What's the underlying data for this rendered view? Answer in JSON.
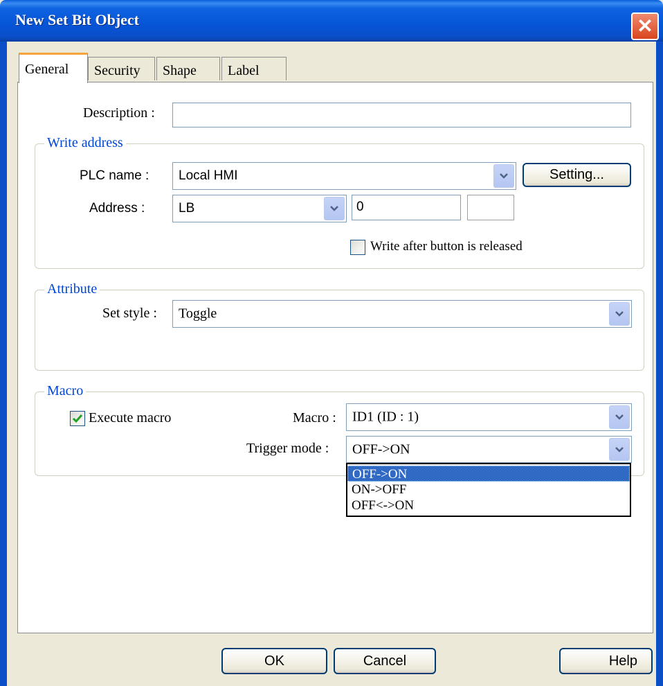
{
  "window": {
    "title": "New  Set Bit Object"
  },
  "tabs": [
    {
      "label": "General",
      "active": true
    },
    {
      "label": "Security",
      "active": false
    },
    {
      "label": "Shape",
      "active": false
    },
    {
      "label": "Label",
      "active": false
    }
  ],
  "description": {
    "label": "Description :",
    "value": ""
  },
  "write_address": {
    "title": "Write address",
    "plc_name_label": "PLC name :",
    "plc_name_value": "Local HMI",
    "setting_button": "Setting...",
    "address_label": "Address :",
    "address_device": "LB",
    "address_value": "0",
    "write_after_release_label": "Write after button is released",
    "write_after_release_checked": false
  },
  "attribute": {
    "title": "Attribute",
    "set_style_label": "Set style :",
    "set_style_value": "Toggle"
  },
  "macro": {
    "title": "Macro",
    "execute_macro_label": "Execute macro",
    "execute_macro_checked": true,
    "macro_label": "Macro :",
    "macro_value": "ID1 (ID : 1)",
    "trigger_mode_label": "Trigger mode :",
    "trigger_mode_value": "OFF->ON",
    "trigger_mode_options": [
      "OFF->ON",
      "ON->OFF",
      "OFF<->ON"
    ]
  },
  "buttons": {
    "ok": "OK",
    "cancel": "Cancel",
    "help": "Help"
  },
  "colors": {
    "titlebar": "#0654d6",
    "group_title": "#0046d5",
    "selection": "#316ac5"
  }
}
